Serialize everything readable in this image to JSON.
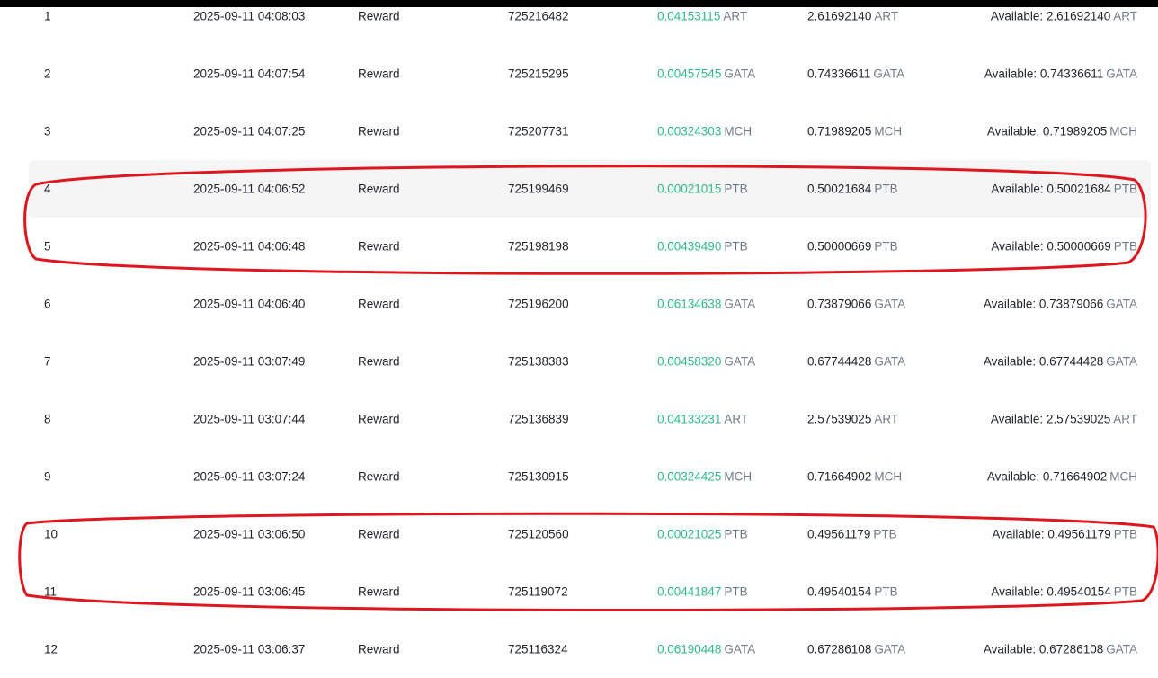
{
  "colors": {
    "positive": "#2ebd85",
    "unit": "#707a8a",
    "text": "#1e2329",
    "highlight": "#f5f5f5",
    "annotation": "#e0161f"
  },
  "rows": [
    {
      "index": "1",
      "time": "2025-09-11 04:08:03",
      "type": "Reward",
      "id": "725216482",
      "amount": "0.04153115",
      "balance": "2.61692140",
      "available_label": "Available: 2.61692140",
      "unit": "ART"
    },
    {
      "index": "2",
      "time": "2025-09-11 04:07:54",
      "type": "Reward",
      "id": "725215295",
      "amount": "0.00457545",
      "balance": "0.74336611",
      "available_label": "Available: 0.74336611",
      "unit": "GATA"
    },
    {
      "index": "3",
      "time": "2025-09-11 04:07:25",
      "type": "Reward",
      "id": "725207731",
      "amount": "0.00324303",
      "balance": "0.71989205",
      "available_label": "Available: 0.71989205",
      "unit": "MCH"
    },
    {
      "index": "4",
      "time": "2025-09-11 04:06:52",
      "type": "Reward",
      "id": "725199469",
      "amount": "0.00021015",
      "balance": "0.50021684",
      "available_label": "Available: 0.50021684",
      "unit": "PTB"
    },
    {
      "index": "5",
      "time": "2025-09-11 04:06:48",
      "type": "Reward",
      "id": "725198198",
      "amount": "0.00439490",
      "balance": "0.50000669",
      "available_label": "Available: 0.50000669",
      "unit": "PTB"
    },
    {
      "index": "6",
      "time": "2025-09-11 04:06:40",
      "type": "Reward",
      "id": "725196200",
      "amount": "0.06134638",
      "balance": "0.73879066",
      "available_label": "Available: 0.73879066",
      "unit": "GATA"
    },
    {
      "index": "7",
      "time": "2025-09-11 03:07:49",
      "type": "Reward",
      "id": "725138383",
      "amount": "0.00458320",
      "balance": "0.67744428",
      "available_label": "Available: 0.67744428",
      "unit": "GATA"
    },
    {
      "index": "8",
      "time": "2025-09-11 03:07:44",
      "type": "Reward",
      "id": "725136839",
      "amount": "0.04133231",
      "balance": "2.57539025",
      "available_label": "Available: 2.57539025",
      "unit": "ART"
    },
    {
      "index": "9",
      "time": "2025-09-11 03:07:24",
      "type": "Reward",
      "id": "725130915",
      "amount": "0.00324425",
      "balance": "0.71664902",
      "available_label": "Available: 0.71664902",
      "unit": "MCH"
    },
    {
      "index": "10",
      "time": "2025-09-11 03:06:50",
      "type": "Reward",
      "id": "725120560",
      "amount": "0.00021025",
      "balance": "0.49561179",
      "available_label": "Available: 0.49561179",
      "unit": "PTB"
    },
    {
      "index": "11",
      "time": "2025-09-11 03:06:45",
      "type": "Reward",
      "id": "725119072",
      "amount": "0.00441847",
      "balance": "0.49540154",
      "available_label": "Available: 0.49540154",
      "unit": "PTB"
    },
    {
      "index": "12",
      "time": "2025-09-11 03:06:37",
      "type": "Reward",
      "id": "725116324",
      "amount": "0.06190448",
      "balance": "0.67286108",
      "available_label": "Available: 0.67286108",
      "unit": "GATA"
    }
  ]
}
